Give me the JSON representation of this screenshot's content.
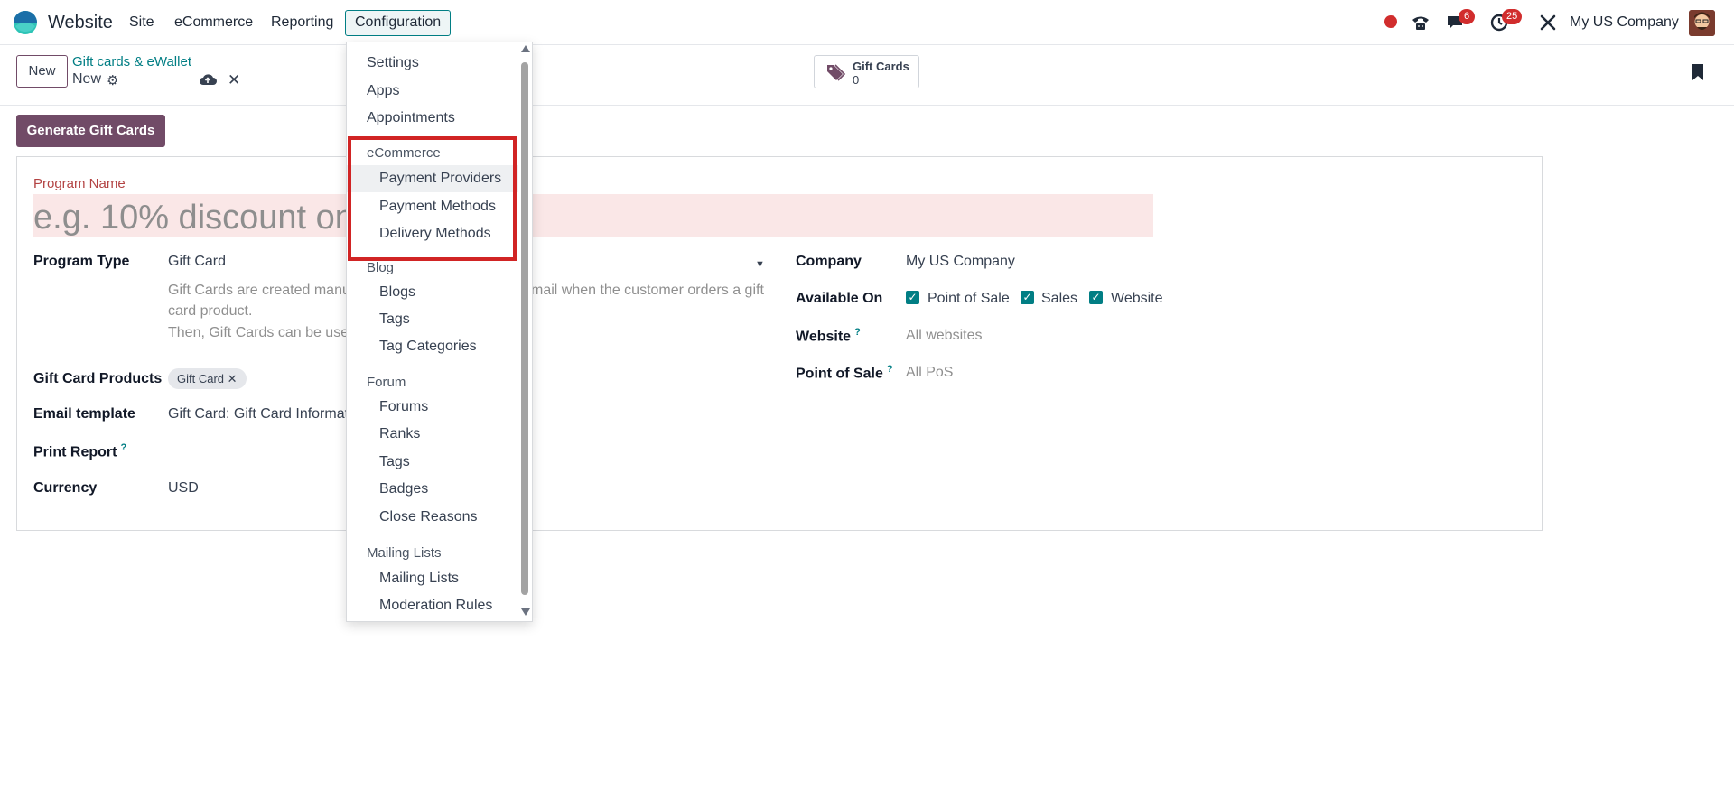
{
  "navbar": {
    "app_name": "Website",
    "menus": [
      "Site",
      "eCommerce",
      "Reporting",
      "Configuration"
    ],
    "messages_count": "6",
    "activities_count": "25",
    "company": "My US Company"
  },
  "control_panel": {
    "new_label": "New",
    "breadcrumb": "Gift cards & eWallet",
    "record_title": "New",
    "smart_button": {
      "label": "Gift Cards",
      "value": "0"
    }
  },
  "form": {
    "generate_label": "Generate Gift Cards",
    "program_name_label": "Program Name",
    "program_name_placeholder": "e.g. 10% discount on",
    "program_type_label": "Program Type",
    "program_type_value": "Gift Card",
    "description_line1": "Gift Cards are created manu",
    "description_line1_tail": "mail when the customer orders a gift",
    "description_line2": "card product.",
    "description_line3": "Then, Gift Cards can be usec",
    "gift_card_products_label": "Gift Card Products",
    "gift_card_product_tag": "Gift Card",
    "email_template_label": "Email template",
    "email_template_value": "Gift Card: Gift Card Informat",
    "print_report_label": "Print Report",
    "currency_label": "Currency",
    "currency_value": "USD",
    "company_label": "Company",
    "company_value": "My US Company",
    "available_on_label": "Available On",
    "available_on": [
      "Point of Sale",
      "Sales",
      "Website"
    ],
    "website_label": "Website",
    "website_placeholder": "All websites",
    "pos_label": "Point of Sale",
    "pos_placeholder": "All PoS"
  },
  "config_menu": {
    "items_top": [
      "Settings",
      "Apps",
      "Appointments"
    ],
    "ecommerce_header": "eCommerce",
    "ecommerce_items": [
      "Payment Providers",
      "Payment Methods",
      "Delivery Methods"
    ],
    "blog_header": "Blog",
    "blog_items": [
      "Blogs",
      "Tags",
      "Tag Categories"
    ],
    "forum_header": "Forum",
    "forum_items": [
      "Forums",
      "Ranks",
      "Tags",
      "Badges",
      "Close Reasons"
    ],
    "mailing_header": "Mailing Lists",
    "mailing_items": [
      "Mailing Lists",
      "Moderation Rules"
    ]
  },
  "colors": {
    "brand": "#714b67",
    "accent": "#017e84",
    "highlight_box": "#d12424"
  }
}
